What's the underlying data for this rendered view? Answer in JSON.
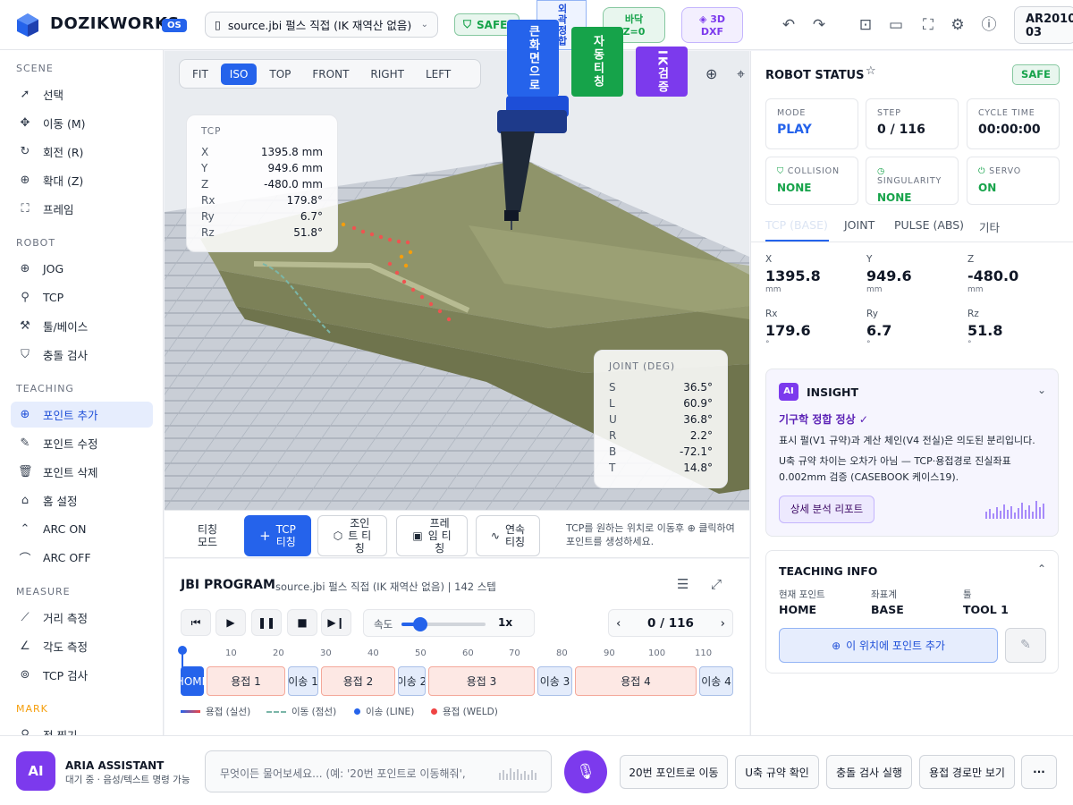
{
  "header": {
    "brand": "DOZIKWORKS",
    "os_badge": "OS",
    "file_name": "source.jbi 펄스 직접 (IK 재역산 없음)",
    "safe_label": "SAFE",
    "floor_line1": "바닥",
    "floor_line2": "Z=0",
    "dxf_line1": "3D",
    "dxf_line2": "DXF",
    "model_line1": "AR2010",
    "model_line2": "03",
    "icons": [
      "undo-icon",
      "redo-icon",
      "camera-icon",
      "video-icon",
      "fullscreen-icon",
      "settings-icon",
      "help-icon"
    ]
  },
  "sidebar": {
    "sections": {
      "scene": "SCENE",
      "robot": "ROBOT",
      "teaching": "TEACHING",
      "measure": "MEASURE",
      "mark": "MARK"
    },
    "scene_items": [
      "선택",
      "이동 (M)",
      "회전 (R)",
      "확대 (Z)",
      "프레임"
    ],
    "robot_items": [
      "JOG",
      "TCP",
      "툴/베이스",
      "충돌 검사"
    ],
    "teaching_items": [
      "포인트 추가",
      "포인트 수정",
      "포인트 삭제",
      "홈 설정",
      "ARC ON",
      "ARC OFF"
    ],
    "measure_items": [
      "거리 측정",
      "각도 측정",
      "TCP 검사"
    ],
    "mark_items": [
      "점 찍기"
    ],
    "mark_color": "#f59e0b",
    "active_item": "포인트 추가"
  },
  "viewport": {
    "view_tabs": [
      "FIT",
      "ISO",
      "TOP",
      "FRONT",
      "RIGHT",
      "LEFT"
    ],
    "active_view": "ISO",
    "overlay_buttons": {
      "blue": "큰화면으로",
      "outline_top": "외곽정합",
      "green": "자동티칭",
      "purple": "IK검증"
    },
    "tcp": {
      "title": "TCP",
      "rows": [
        {
          "k": "X",
          "v": "1395.8 mm"
        },
        {
          "k": "Y",
          "v": "949.6 mm"
        },
        {
          "k": "Z",
          "v": "-480.0 mm"
        },
        {
          "k": "Rx",
          "v": "179.8°"
        },
        {
          "k": "Ry",
          "v": "6.7°"
        },
        {
          "k": "Rz",
          "v": "51.8°"
        }
      ]
    },
    "joint": {
      "title": "JOINT (DEG)",
      "rows": [
        {
          "k": "S",
          "v": "36.5°"
        },
        {
          "k": "L",
          "v": "60.9°"
        },
        {
          "k": "U",
          "v": "36.8°"
        },
        {
          "k": "R",
          "v": "2.2°"
        },
        {
          "k": "B",
          "v": "-72.1°"
        },
        {
          "k": "T",
          "v": "14.8°"
        }
      ]
    }
  },
  "teachbar": {
    "mode_l1": "티칭",
    "mode_l2": "모드",
    "tcp_l1": "TCP",
    "tcp_l2": "티칭",
    "joint_l1": "조인",
    "joint_l2": "트 티",
    "joint_l3": "칭",
    "frame_l1": "프레",
    "frame_l2": "임 티",
    "frame_l3": "칭",
    "cont_l1": "연속",
    "cont_l2": "티칭",
    "hint": "TCP를 원하는 위치로 이동후 ⊕ 클릭하여 포인트를 생성하세요."
  },
  "program": {
    "title": "JBI PROGRAM",
    "subtitle": "source.jbi 펄스 직접 (IK 재역산 없음) | 142 스텝",
    "speed_label": "속도",
    "speed_value": "1x",
    "speed_fraction": 0.22,
    "step_display": "0 / 116",
    "ticks": [
      "10",
      "20",
      "30",
      "40",
      "50",
      "60",
      "70",
      "80",
      "90",
      "100",
      "110"
    ],
    "segments": [
      {
        "label": "HOME",
        "type": "home"
      },
      {
        "label": "용접 1",
        "type": "weld"
      },
      {
        "label": "이송 1",
        "type": "move"
      },
      {
        "label": "용접 2",
        "type": "weld"
      },
      {
        "label": "이송 2",
        "type": "move"
      },
      {
        "label": "용접 3",
        "type": "weld"
      },
      {
        "label": "이송 3",
        "type": "move"
      },
      {
        "label": "용접 4",
        "type": "weld"
      },
      {
        "label": "이송 4",
        "type": "move"
      }
    ],
    "legend": [
      "용접 (실선)",
      "이동 (점선)",
      "이송 (LINE)",
      "용접 (WELD)"
    ]
  },
  "robot_status": {
    "title": "ROBOT STATUS",
    "safe": "SAFE",
    "mode_label": "MODE",
    "mode": "PLAY",
    "step_label": "STEP",
    "step": "0 / 116",
    "cycle_label": "CYCLE TIME",
    "cycle": "00:00:00",
    "collision_label": "COLLISION",
    "collision": "NONE",
    "singularity_label": "SINGULARITY",
    "singularity": "NONE",
    "servo_label": "SERVO",
    "servo": "ON",
    "tabs": [
      "TCP (BASE)",
      "JOINT",
      "PULSE (ABS)",
      "기타"
    ],
    "coords": [
      {
        "k": "X",
        "v": "1395.8",
        "u": "mm"
      },
      {
        "k": "Y",
        "v": "949.6",
        "u": "mm"
      },
      {
        "k": "Z",
        "v": "-480.0",
        "u": "mm"
      },
      {
        "k": "Rx",
        "v": "179.6",
        "u": "°"
      },
      {
        "k": "Ry",
        "v": "6.7",
        "u": "°"
      },
      {
        "k": "Rz",
        "v": "51.8",
        "u": "°"
      }
    ]
  },
  "insight": {
    "badge": "AI",
    "title": "INSIGHT",
    "headline": "기구학 정합 정상 ✓",
    "line1": "표시 펄(V1 규약)과 계산 체인(V4 전실)은 의도된 분리입니다.",
    "line2": "U축 규약 차이는 오차가 아님 — TCP·용접경로 진실좌표 0.002mm 검증 (CASEBOOK 케이스19).",
    "report_button": "상세 분석 리포트"
  },
  "teaching_info": {
    "title": "TEACHING INFO",
    "col1_label": "현재 포인트",
    "col1_value": "HOME",
    "col2_label": "좌표계",
    "col2_value": "BASE",
    "col3_label": "툴",
    "col3_value": "TOOL 1",
    "add_button": "이 위치에 포인트 추가"
  },
  "assistant": {
    "badge": "AI",
    "name": "ARIA ASSISTANT",
    "status": "대기 중 · 음성/텍스트 명령 가능",
    "placeholder": "무엇이든 물어보세요... (예: '20번 포인트로 이동해줘',",
    "quick": [
      "20번 포인트로 이동",
      "U축 규약 확인",
      "충돌 검사 실행",
      "용접 경로만 보기"
    ],
    "more": "···"
  }
}
